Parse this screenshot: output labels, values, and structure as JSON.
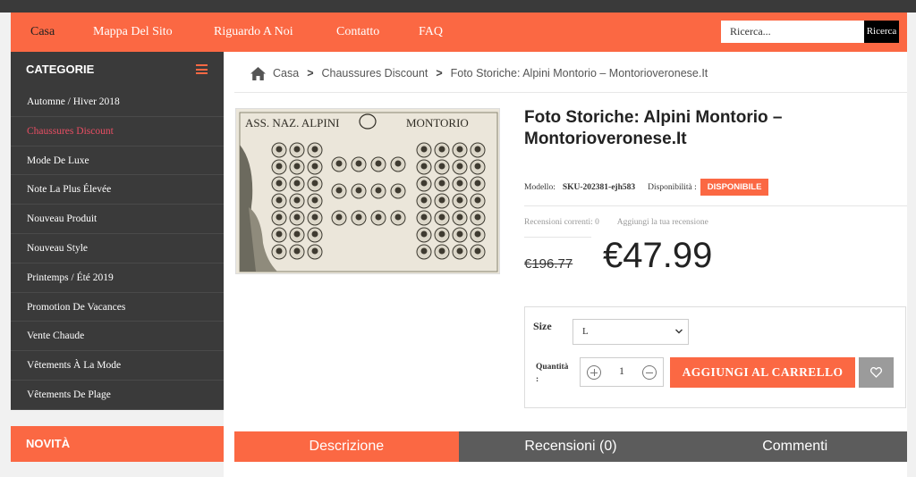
{
  "nav": {
    "items": [
      "Casa",
      "Mappa Del Sito",
      "Riguardo A Noi",
      "Contatto",
      "FAQ"
    ],
    "search_placeholder": "Ricerca...",
    "search_button": "Ricerca"
  },
  "sidebar": {
    "heading": "CATEGORIE",
    "items": [
      {
        "label": "Automne / Hiver 2018"
      },
      {
        "label": "Chaussures Discount",
        "active": true
      },
      {
        "label": "Mode De Luxe"
      },
      {
        "label": "Note La Plus Élevée"
      },
      {
        "label": "Nouveau Produit"
      },
      {
        "label": "Nouveau Style"
      },
      {
        "label": "Printemps / Été 2019"
      },
      {
        "label": "Promotion De Vacances"
      },
      {
        "label": "Vente Chaude"
      },
      {
        "label": "Vêtements À La Mode"
      },
      {
        "label": "Vêtements De Plage"
      }
    ],
    "new_heading": "NOVITÀ"
  },
  "breadcrumb": [
    "Casa",
    "Chaussures Discount",
    "Foto Storiche: Alpini Montorio – Montorioveronese.It"
  ],
  "product": {
    "image_caption_left": "ASS. NAZ. ALPINI",
    "image_caption_right": "MONTORIO",
    "title": "Foto Storiche: Alpini Montorio – Montorioveronese.It",
    "model_label": "Modello:",
    "model_value": "SKU-202381-ejh583",
    "availability_label": "Disponibilità :",
    "availability_value": "DISPONIBILE",
    "reviews_current": "Recensioni correnti: 0",
    "reviews_add": "Aggiungi la tua recensione",
    "old_price": "€196.77",
    "price": "€47.99",
    "size_label": "Size",
    "size_value": "L",
    "qty_label": "Quantità :",
    "qty_value": "1",
    "add_to_cart": "AGGIUNGI AL CARRELLO"
  },
  "tabs": [
    "Descrizione",
    "Recensioni (0)",
    "Commenti"
  ],
  "colors": {
    "accent": "#fb6843",
    "dark": "#3a3a3a",
    "active_category": "#e94e63"
  }
}
